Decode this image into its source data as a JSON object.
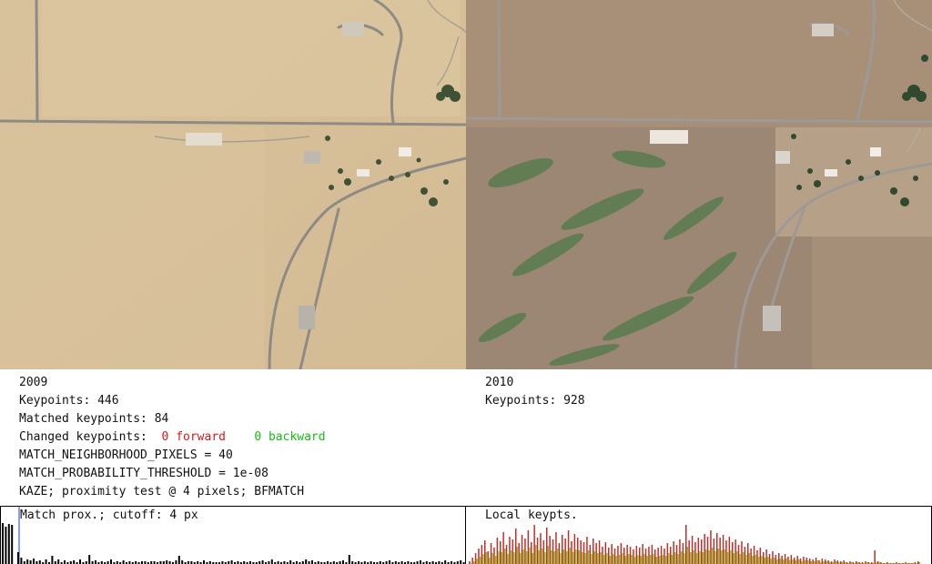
{
  "left_image": {
    "label": "2009",
    "keypoints_text": "Keypoints: 446",
    "matched_text": "Matched keypoints: 84",
    "changed_prefix": "Changed keypoints:",
    "forward_text": "0 forward",
    "backward_text": "0 backward",
    "neighborhood_text": "MATCH_NEIGHBORHOOD_PIXELS = 40",
    "threshold_text": "MATCH_PROBABILITY_THRESHOLD = 1e-08",
    "method_text": "KAZE; proximity test @ 4 pixels; BFMATCH"
  },
  "right_image": {
    "label": "2010",
    "keypoints_text": "Keypoints: 928"
  },
  "colors": {
    "forward": "#d41a1a",
    "backward": "#19b919",
    "hist_bar": "#000000",
    "hist_red": "#c0302a",
    "hist_green": "#8fbf22"
  },
  "chart_data": [
    {
      "type": "bar",
      "title": "Match prox.; cutoff: 4 px",
      "values": [
        46,
        42,
        45,
        44,
        0,
        14,
        8,
        4,
        6,
        5,
        7,
        4,
        5,
        3,
        6,
        3,
        10,
        4,
        6,
        3,
        5,
        3,
        4,
        5,
        3,
        6,
        3,
        4,
        11,
        4,
        5,
        3,
        4,
        3,
        4,
        6,
        3,
        4,
        3,
        5,
        3,
        4,
        3,
        4,
        3,
        4,
        4,
        3,
        4,
        4,
        3,
        4,
        4,
        5,
        4,
        3,
        5,
        10,
        5,
        3,
        4,
        4,
        3,
        4,
        3,
        5,
        3,
        4,
        3,
        3,
        3,
        4,
        3,
        4,
        5,
        3,
        4,
        3,
        4,
        3,
        4,
        3,
        3,
        4,
        5,
        3,
        4,
        6,
        3,
        4,
        3,
        4,
        3,
        5,
        3,
        4,
        3,
        4,
        6,
        4,
        5,
        3,
        4,
        3,
        3,
        4,
        3,
        4,
        3,
        4,
        5,
        3,
        11,
        4,
        3,
        4,
        3,
        4,
        3,
        4,
        3,
        3,
        4,
        3,
        4,
        5,
        3,
        4,
        3,
        4,
        3,
        4,
        3,
        3,
        4,
        5,
        3,
        4,
        3,
        4,
        3,
        4,
        3,
        5,
        3,
        4,
        3,
        4,
        5,
        3
      ]
    },
    {
      "type": "bar",
      "title": "Local keypts.",
      "series": [
        {
          "values": [
            4,
            8,
            13,
            18,
            22,
            27,
            15,
            24,
            19,
            30,
            26,
            36,
            22,
            31,
            28,
            40,
            24,
            33,
            29,
            38,
            25,
            44,
            30,
            35,
            27,
            41,
            32,
            28,
            36,
            24,
            33,
            29,
            38,
            26,
            34,
            30,
            27,
            25,
            31,
            22,
            29,
            24,
            27,
            20,
            25,
            19,
            23,
            18,
            21,
            24,
            19,
            22,
            20,
            17,
            21,
            19,
            23,
            18,
            20,
            22,
            17,
            19,
            21,
            18,
            24,
            20,
            26,
            22,
            28,
            24,
            44,
            27,
            32,
            25,
            30,
            28,
            34,
            31,
            38,
            29,
            35,
            30,
            33,
            27,
            31,
            25,
            28,
            22,
            26,
            20,
            24,
            18,
            21,
            16,
            19,
            14,
            17,
            12,
            15,
            11,
            13,
            10,
            12,
            9,
            11,
            8,
            10,
            7,
            9,
            8,
            7,
            6,
            8,
            5,
            7,
            6,
            5,
            4,
            6,
            5,
            4,
            5,
            3,
            4,
            3,
            4,
            3,
            3,
            4,
            3,
            3,
            16,
            4,
            3,
            2,
            3,
            2,
            2,
            3,
            2,
            2,
            3,
            2,
            2,
            3,
            4
          ]
        },
        {
          "values": [
            2,
            4,
            7,
            9,
            12,
            14,
            8,
            13,
            10,
            15,
            14,
            18,
            12,
            16,
            14,
            20,
            13,
            17,
            15,
            19,
            13,
            22,
            16,
            18,
            14,
            21,
            16,
            15,
            18,
            13,
            17,
            15,
            19,
            14,
            17,
            16,
            14,
            13,
            16,
            12,
            15,
            13,
            14,
            11,
            13,
            10,
            12,
            10,
            11,
            13,
            10,
            12,
            11,
            9,
            11,
            10,
            12,
            10,
            11,
            12,
            9,
            10,
            11,
            10,
            13,
            11,
            14,
            12,
            15,
            13,
            20,
            14,
            16,
            13,
            15,
            14,
            17,
            16,
            19,
            15,
            18,
            16,
            17,
            14,
            16,
            13,
            15,
            12,
            14,
            11,
            13,
            10,
            11,
            9,
            10,
            8,
            9,
            7,
            8,
            6,
            7,
            6,
            7,
            5,
            6,
            5,
            6,
            4,
            5,
            5,
            4,
            4,
            5,
            3,
            4,
            4,
            3,
            3,
            4,
            3,
            3,
            3,
            2,
            3,
            2,
            3,
            2,
            2,
            3,
            2,
            2,
            3,
            3,
            2,
            2,
            2,
            2,
            2,
            2,
            2,
            2,
            2,
            2,
            2,
            2,
            3
          ]
        }
      ]
    }
  ]
}
